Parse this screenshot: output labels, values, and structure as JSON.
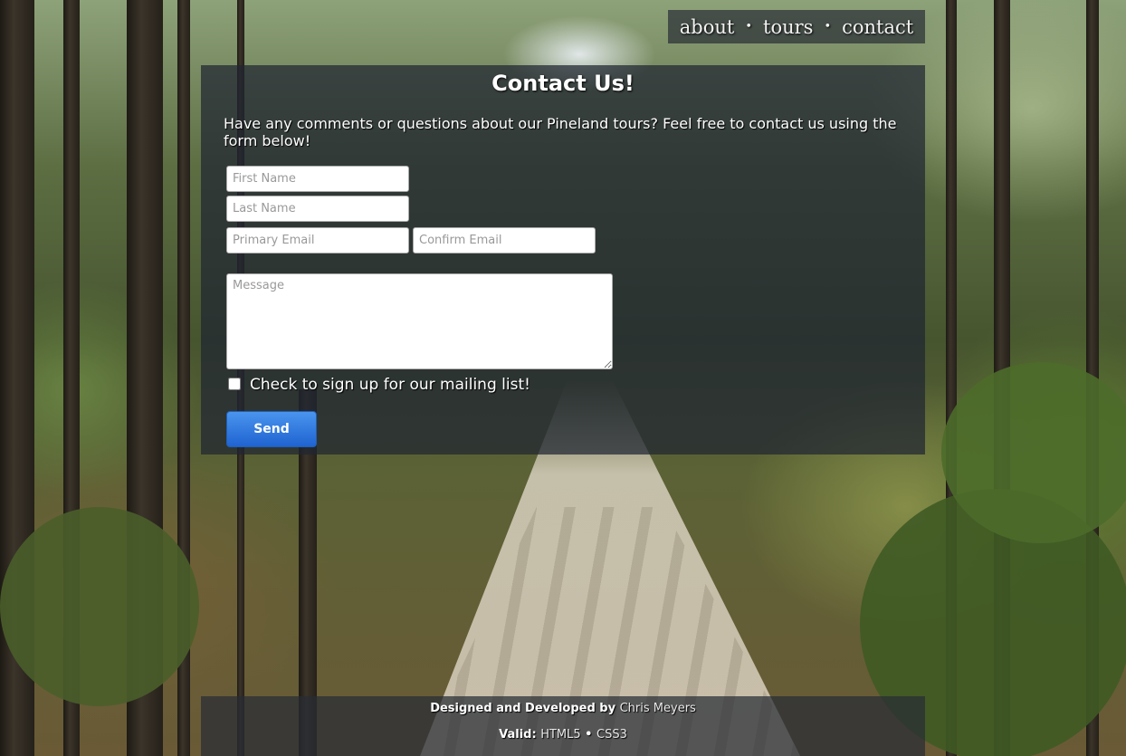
{
  "nav": {
    "items": [
      "about",
      "tours",
      "contact"
    ],
    "separator": "•"
  },
  "contact": {
    "title": "Contact Us!",
    "intro": "Have any comments or questions about our Pineland tours? Feel free to contact us using the form below!",
    "first_name_placeholder": "First Name",
    "last_name_placeholder": "Last Name",
    "primary_email_placeholder": "Primary Email",
    "confirm_email_placeholder": "Confirm Email",
    "message_placeholder": "Message",
    "mailing_list_label": "Check to sign up for our mailing list!",
    "send_label": "Send"
  },
  "footer": {
    "credit_prefix": "Designed and Developed by",
    "author": "Chris Meyers",
    "valid_prefix": "Valid:",
    "html5": "HTML5",
    "separator": "•",
    "css3": "CSS3"
  },
  "colors": {
    "button": "#2b74dc",
    "panel": "#202632"
  }
}
